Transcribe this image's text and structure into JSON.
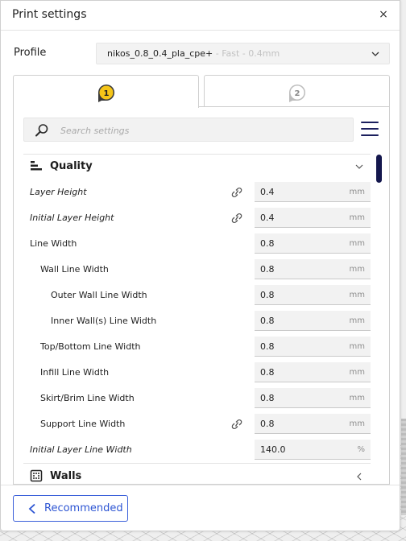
{
  "dialog": {
    "title": "Print settings",
    "close_label": "×"
  },
  "profile": {
    "label": "Profile",
    "name": "nikos_0.8_0.4_pla_cpe+",
    "subtitle": " - Fast - 0.4mm"
  },
  "extruder_tabs": [
    {
      "number": "1",
      "active": true
    },
    {
      "number": "2",
      "active": false
    }
  ],
  "search": {
    "placeholder": "Search settings",
    "value": ""
  },
  "categories": {
    "quality": {
      "title": "Quality",
      "expanded": true
    },
    "walls": {
      "title": "Walls",
      "expanded": false
    }
  },
  "settings": [
    {
      "label": "Layer Height",
      "value": "0.4",
      "unit": "mm",
      "italic": true,
      "linked": true
    },
    {
      "label": "Initial Layer Height",
      "value": "0.4",
      "unit": "mm",
      "italic": true,
      "linked": true
    },
    {
      "label": "Line Width",
      "value": "0.8",
      "unit": "mm",
      "italic": false,
      "linked": false
    },
    {
      "label": "Wall Line Width",
      "value": "0.8",
      "unit": "mm",
      "italic": false,
      "linked": false
    },
    {
      "label": "Outer Wall Line Width",
      "value": "0.8",
      "unit": "mm",
      "italic": false,
      "linked": false
    },
    {
      "label": "Inner Wall(s) Line Width",
      "value": "0.8",
      "unit": "mm",
      "italic": false,
      "linked": false
    },
    {
      "label": "Top/Bottom Line Width",
      "value": "0.8",
      "unit": "mm",
      "italic": false,
      "linked": false
    },
    {
      "label": "Infill Line Width",
      "value": "0.8",
      "unit": "mm",
      "italic": false,
      "linked": false
    },
    {
      "label": "Skirt/Brim Line Width",
      "value": "0.8",
      "unit": "mm",
      "italic": false,
      "linked": false
    },
    {
      "label": "Support Line Width",
      "value": "0.8",
      "unit": "mm",
      "italic": false,
      "linked": true
    },
    {
      "label": "Initial Layer Line Width",
      "value": "140.0",
      "unit": "%",
      "italic": true,
      "linked": false
    }
  ],
  "footer": {
    "recommended_label": "Recommended"
  },
  "colors": {
    "accent": "#2d55d3",
    "badge_active": "#f5c518",
    "scrollbar": "#14174d"
  }
}
